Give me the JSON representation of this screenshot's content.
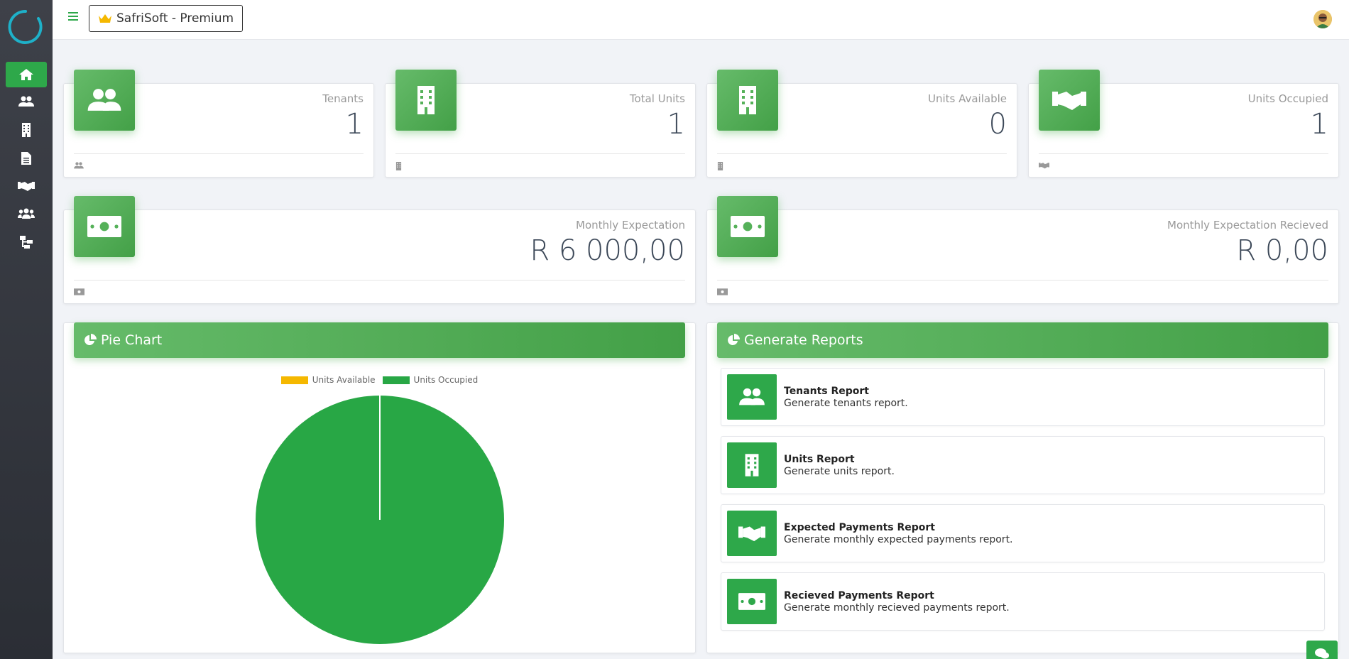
{
  "topbar": {
    "brand_label": "SafriSoft - Premium"
  },
  "sidebar": {
    "items": [
      {
        "icon": "home-icon",
        "active": true
      },
      {
        "icon": "users-icon"
      },
      {
        "icon": "building-icon"
      },
      {
        "icon": "document-icon"
      },
      {
        "icon": "handshake-icon"
      },
      {
        "icon": "group-icon"
      },
      {
        "icon": "sitemap-icon"
      }
    ]
  },
  "stats": [
    {
      "label": "Tenants",
      "value": "1",
      "icon": "users-icon"
    },
    {
      "label": "Total Units",
      "value": "1",
      "icon": "building-icon"
    },
    {
      "label": "Units Available",
      "value": "0",
      "icon": "building-icon"
    },
    {
      "label": "Units Occupied",
      "value": "1",
      "icon": "handshake-icon"
    }
  ],
  "money": [
    {
      "label": "Monthly Expectation",
      "value": "R 6 000,00",
      "icon": "money-icon"
    },
    {
      "label": "Monthly Expectation Recieved",
      "value": "R 0,00",
      "icon": "money-icon"
    }
  ],
  "pie_panel": {
    "title": "Pie Chart"
  },
  "chart_data": {
    "type": "pie",
    "categories": [
      "Units Available",
      "Units Occupied"
    ],
    "values": [
      0,
      1
    ],
    "colors": [
      "#f5b800",
      "#28a745"
    ],
    "legend_placement": "top"
  },
  "reports_panel": {
    "title": "Generate Reports",
    "items": [
      {
        "title": "Tenants Report",
        "desc": "Generate tenants report.",
        "icon": "users-icon"
      },
      {
        "title": "Units Report",
        "desc": "Generate units report.",
        "icon": "building-icon"
      },
      {
        "title": "Expected Payments Report",
        "desc": "Generate monthly expected payments report.",
        "icon": "handshake-icon"
      },
      {
        "title": "Recieved Payments Report",
        "desc": "Generate monthly recieved payments report.",
        "icon": "money-icon"
      }
    ]
  },
  "colors": {
    "accent": "#2ea84a",
    "sidebar": "#3e4149"
  }
}
